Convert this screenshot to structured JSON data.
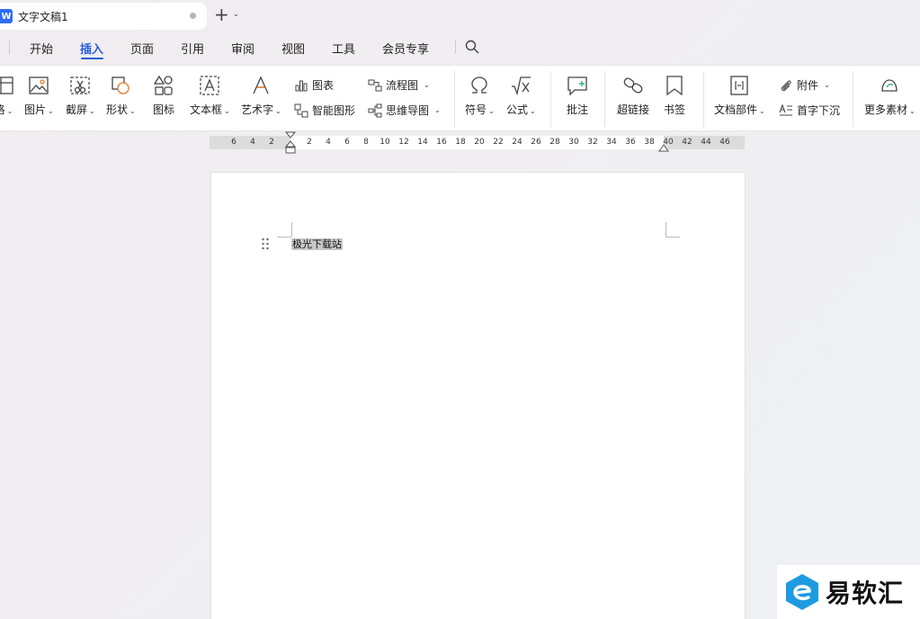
{
  "tab": {
    "app_badge": "W",
    "title": "文字文稿1"
  },
  "menu": {
    "items": [
      "开始",
      "插入",
      "页面",
      "引用",
      "审阅",
      "视图",
      "工具",
      "会员专享"
    ],
    "active": "插入"
  },
  "ribbon": {
    "partial_label": "格",
    "picture": "图片",
    "screenshot": "截屏",
    "shape": "形状",
    "icon": "图标",
    "textbox": "文本框",
    "wordart": "艺术字",
    "chart": "图表",
    "smartart": "智能图形",
    "flowchart": "流程图",
    "mindmap": "思维导图",
    "symbol": "符号",
    "formula": "公式",
    "comment": "批注",
    "hyperlink": "超链接",
    "bookmark": "书签",
    "docparts": "文档部件",
    "attachment": "附件",
    "dropcap": "首字下沉",
    "more": "更多素材"
  },
  "ruler": {
    "ticks": [
      "6",
      "4",
      "2",
      "2",
      "4",
      "6",
      "8",
      "10",
      "12",
      "14",
      "16",
      "18",
      "20",
      "22",
      "24",
      "26",
      "28",
      "30",
      "32",
      "34",
      "36",
      "38",
      "40",
      "42",
      "44",
      "46"
    ]
  },
  "document": {
    "selected_text": "极光下载站"
  },
  "watermark": {
    "text": "易软汇",
    "color": "#1e9be0"
  },
  "colors": {
    "accent": "#2b5fd9"
  }
}
